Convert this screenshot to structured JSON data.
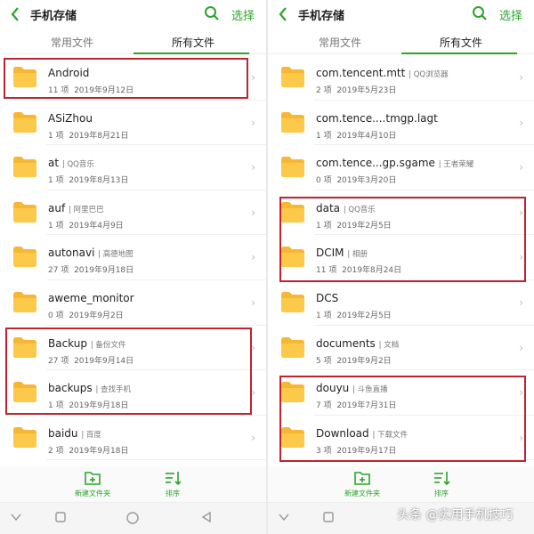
{
  "colors": {
    "accent": "#2aa52a",
    "highlight": "#c0232f",
    "folder": "#f7b733"
  },
  "left": {
    "header": {
      "title": "手机存储",
      "select_label": "选择"
    },
    "tabs": [
      "常用文件",
      "所有文件"
    ],
    "folders": [
      {
        "name": "Android",
        "tag": "",
        "count": "11 项",
        "date": "2019年9月12日"
      },
      {
        "name": "ASiZhou",
        "tag": "",
        "count": "1 项",
        "date": "2019年8月21日"
      },
      {
        "name": "at",
        "tag": "| QQ音乐",
        "count": "1 项",
        "date": "2019年8月13日"
      },
      {
        "name": "auf",
        "tag": "| 阿里巴巴",
        "count": "1 项",
        "date": "2019年4月9日"
      },
      {
        "name": "autonavi",
        "tag": "| 高德地图",
        "count": "27 项",
        "date": "2019年9月18日"
      },
      {
        "name": "aweme_monitor",
        "tag": "",
        "count": "0 项",
        "date": "2019年9月2日"
      },
      {
        "name": "Backup",
        "tag": "| 备份文件",
        "count": "27 项",
        "date": "2019年9月14日"
      },
      {
        "name": "backups",
        "tag": "| 查找手机",
        "count": "1 项",
        "date": "2019年9月18日"
      },
      {
        "name": "baidu",
        "tag": "| 百度",
        "count": "2 项",
        "date": "2019年9月18日"
      }
    ],
    "bottom": {
      "new_folder": "新建文件夹",
      "sort": "排序"
    }
  },
  "right": {
    "header": {
      "title": "手机存储",
      "select_label": "选择"
    },
    "tabs": [
      "常用文件",
      "所有文件"
    ],
    "folders": [
      {
        "name": "com.tencent.mtt",
        "tag": "| QQ浏览器",
        "count": "2 项",
        "date": "2019年5月23日"
      },
      {
        "name": "com.tence....tmgp.lagt",
        "tag": "",
        "count": "1 项",
        "date": "2019年4月10日"
      },
      {
        "name": "com.tence...gp.sgame",
        "tag": "| 王者荣耀",
        "count": "0 项",
        "date": "2019年3月20日"
      },
      {
        "name": "data",
        "tag": "| QQ音乐",
        "count": "1 项",
        "date": "2019年2月5日"
      },
      {
        "name": "DCIM",
        "tag": "| 相册",
        "count": "11 项",
        "date": "2019年8月24日"
      },
      {
        "name": "DCS",
        "tag": "",
        "count": "1 项",
        "date": "2019年2月5日"
      },
      {
        "name": "documents",
        "tag": "| 文档",
        "count": "5 项",
        "date": "2019年9月2日"
      },
      {
        "name": "douyu",
        "tag": "| 斗鱼直播",
        "count": "7 项",
        "date": "2019年7月31日"
      },
      {
        "name": "Download",
        "tag": "| 下载文件",
        "count": "3 项",
        "date": "2019年9月17日"
      }
    ],
    "bottom": {
      "new_folder": "新建文件夹",
      "sort": "排序"
    }
  },
  "watermark": "头条 @实用手机技巧"
}
